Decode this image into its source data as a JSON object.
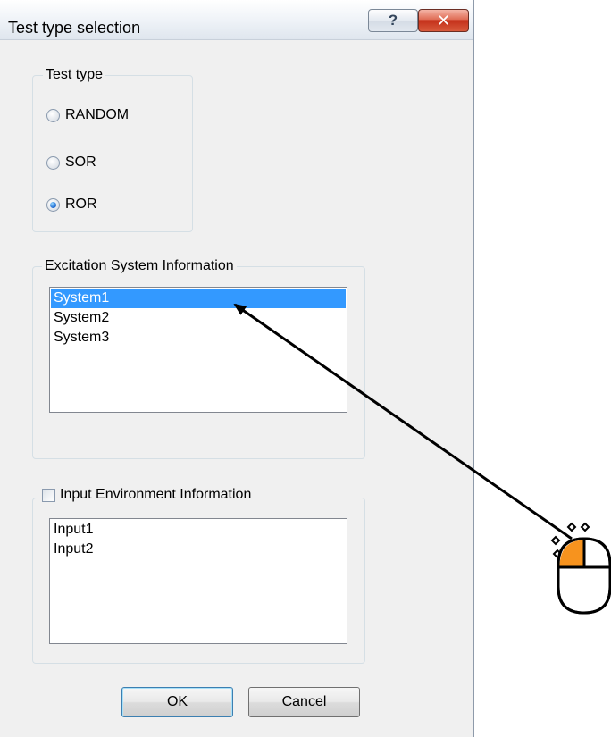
{
  "window": {
    "title": "Test type selection",
    "help_label": "?",
    "close_label": "✕"
  },
  "test_type": {
    "legend": "Test type",
    "options": [
      "RANDOM",
      "SOR",
      "ROR"
    ],
    "selected": "ROR"
  },
  "excitation": {
    "legend": "Excitation System Information",
    "items": [
      "System1",
      "System2",
      "System3"
    ],
    "selected": "System1"
  },
  "input_env": {
    "legend": "Input Environment Information",
    "checked": false,
    "items": [
      "Input1",
      "Input2"
    ]
  },
  "buttons": {
    "ok": "OK",
    "cancel": "Cancel"
  },
  "annotation": {
    "arrow": "arrow pointing from mouse icon to System1",
    "mouse_icon": "mouse-left-click-icon",
    "highlight_color": "#f7931e"
  },
  "colors": {
    "selection": "#3399ff",
    "dialog_bg": "#f0f0f0"
  }
}
